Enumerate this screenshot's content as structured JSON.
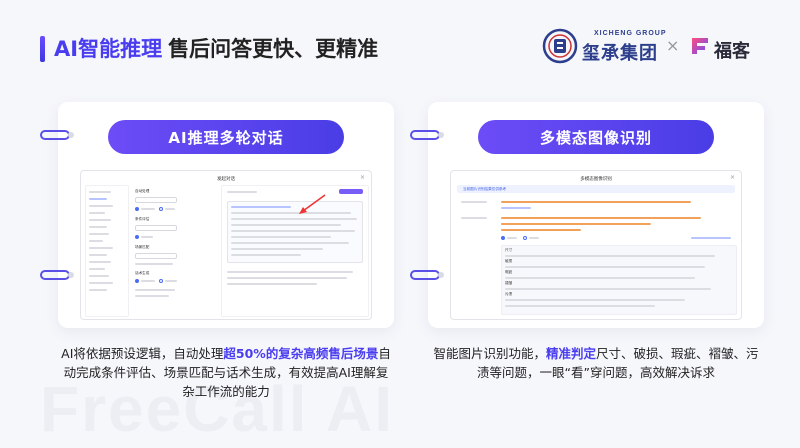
{
  "page": {
    "title_accent": "AI智能推理",
    "title_rest": "售后问答更快、更精准"
  },
  "logos": {
    "xicheng_cn": "玺承集团",
    "xicheng_en": "XICHENG GROUP",
    "separator": "×",
    "fuke_name": "福客",
    "seal_icon": "xicheng-seal-icon",
    "fuke_icon": "fuke-logo-icon"
  },
  "watermark": "FreeCall AI",
  "cards": [
    {
      "pill": "AI推理多轮对话",
      "mockup": {
        "title": "发起对话",
        "close": "×",
        "labels": [
          "自动处理",
          "条件评估",
          "场景匹配",
          "话术生成"
        ]
      },
      "caption": {
        "part1": "AI将依据预设逻辑，自动处理",
        "highlight": "超50%的复杂高频售后场景",
        "part2": "自动完成条件评估、场景匹配与话术生成，有效提高AI理解复杂工作流的能力"
      }
    },
    {
      "pill": "多模态图像识别",
      "mockup": {
        "title": "多模态图像识别",
        "close": "×",
        "info": "当前图片识别结果仅供参考",
        "labels": [
          "尺寸",
          "破损",
          "瑕疵",
          "褶皱",
          "污渍"
        ]
      },
      "caption": {
        "part1": "智能图片识别功能，",
        "highlight": "精准判定",
        "part2": "尺寸、破损、瑕疵、褶皱、污渍等问题，一眼“看”穿问题，高效解决诉求"
      }
    }
  ],
  "colors": {
    "accent": "#4a3df0",
    "pill_start": "#6c4cf6",
    "pill_end": "#4a3de6",
    "ring": "#5a50e8",
    "background": "#f6f7fb"
  }
}
